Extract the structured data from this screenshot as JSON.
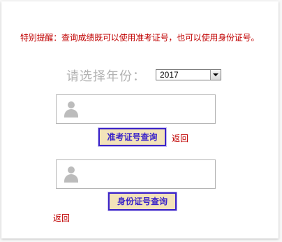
{
  "notice": "特别提醒：查询成绩既可以使用准考证号，也可以使用身份证号。",
  "year_select": {
    "label": "请选择年份：",
    "value": "2017"
  },
  "exam_query": {
    "button_label": "准考证号查询",
    "back_label": "返回"
  },
  "id_query": {
    "button_label": "身份证号查询",
    "back_label": "返回"
  },
  "colors": {
    "notice": "#c00000",
    "button_bg": "#f3e3b9",
    "button_border": "#3a23c9"
  }
}
